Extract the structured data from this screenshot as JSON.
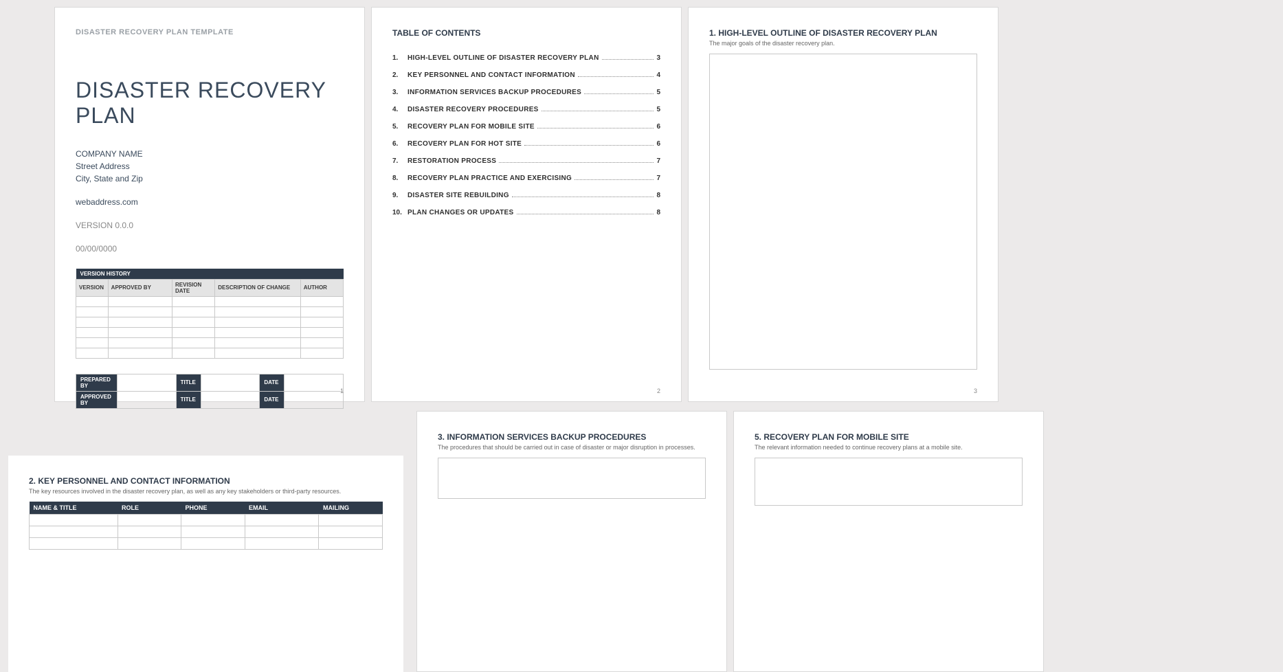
{
  "page1": {
    "header": "DISASTER RECOVERY PLAN TEMPLATE",
    "title": "DISASTER RECOVERY PLAN",
    "company": "COMPANY NAME",
    "street": "Street Address",
    "city": "City, State and Zip",
    "web": "webaddress.com",
    "version_label": "VERSION 0.0.0",
    "date": "00/00/0000",
    "vh_title": "VERSION HISTORY",
    "vh_cols": {
      "c1": "VERSION",
      "c2": "APPROVED BY",
      "c3": "REVISION DATE",
      "c4": "DESCRIPTION OF CHANGE",
      "c5": "AUTHOR"
    },
    "sign": {
      "prepared": "PREPARED BY",
      "approved": "APPROVED BY",
      "title": "TITLE",
      "date": "DATE"
    },
    "num": "1"
  },
  "page2": {
    "heading": "TABLE OF CONTENTS",
    "items": [
      {
        "n": "1.",
        "t": "HIGH-LEVEL OUTLINE OF DISASTER RECOVERY PLAN",
        "p": "3"
      },
      {
        "n": "2.",
        "t": "KEY PERSONNEL AND CONTACT INFORMATION",
        "p": "4"
      },
      {
        "n": "3.",
        "t": "INFORMATION SERVICES BACKUP PROCEDURES",
        "p": "5"
      },
      {
        "n": "4.",
        "t": "DISASTER RECOVERY PROCEDURES",
        "p": "5"
      },
      {
        "n": "5.",
        "t": "RECOVERY PLAN FOR MOBILE SITE",
        "p": "6"
      },
      {
        "n": "6.",
        "t": "RECOVERY PLAN FOR HOT SITE",
        "p": "6"
      },
      {
        "n": "7.",
        "t": "RESTORATION PROCESS",
        "p": "7"
      },
      {
        "n": "8.",
        "t": "RECOVERY PLAN PRACTICE AND EXERCISING",
        "p": "7"
      },
      {
        "n": "9.",
        "t": "DISASTER SITE REBUILDING",
        "p": "8"
      },
      {
        "n": "10.",
        "t": "PLAN CHANGES OR UPDATES",
        "p": "8"
      }
    ],
    "num": "2"
  },
  "page3": {
    "heading": "1.  HIGH-LEVEL OUTLINE OF DISASTER RECOVERY PLAN",
    "sub": "The major goals of the disaster recovery plan.",
    "num": "3"
  },
  "page4": {
    "heading": "2.  KEY PERSONNEL AND CONTACT INFORMATION",
    "sub": "The key resources involved in the disaster recovery plan, as well as any key stakeholders or third-party resources.",
    "cols": {
      "c1": "NAME & TITLE",
      "c2": "ROLE",
      "c3": "PHONE",
      "c4": "EMAIL",
      "c5": "MAILING"
    }
  },
  "page5": {
    "heading": "3.  INFORMATION SERVICES BACKUP PROCEDURES",
    "sub": "The procedures that should be carried out in case of disaster or major disruption in processes."
  },
  "page6": {
    "heading": "5.  RECOVERY PLAN FOR MOBILE SITE",
    "sub": "The relevant information needed to continue recovery plans at a mobile site."
  }
}
